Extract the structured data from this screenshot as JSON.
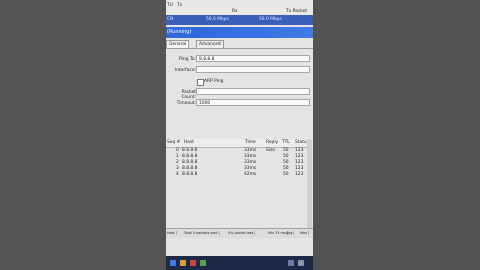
{
  "columns": {
    "col1": "TU",
    "col2": "Tx",
    "col3": "Rx",
    "col4": "Tx Packet",
    "col5": "R"
  },
  "interface_row": {
    "name": "CN",
    "tx_rate": "56.0 Mbps",
    "rx_rate": "56.0 Mbps"
  },
  "window": {
    "title": "(Running)"
  },
  "tabs": [
    "General",
    "Advanced"
  ],
  "form": {
    "ping_to_label": "Ping To:",
    "ping_to_value": "8.8.8.8",
    "interface_label": "Interface:",
    "interface_value": "",
    "arp_ping_label": "ARP Ping",
    "packet_count_label": "Packet Count:",
    "packet_count_value": "",
    "timeout_label": "Timeout:",
    "timeout_value": "1000"
  },
  "results": {
    "headers": [
      "Seq #",
      "Host",
      "Time",
      "Reply Size",
      "TTL",
      "Status"
    ],
    "rows": [
      {
        "seq": "0",
        "host": "8.8.8.8",
        "time": "33ms",
        "size": "50",
        "ttl": "123"
      },
      {
        "seq": "1",
        "host": "8.8.8.8",
        "time": "33ms",
        "size": "50",
        "ttl": "123"
      },
      {
        "seq": "2",
        "host": "8.8.8.8",
        "time": "33ms",
        "size": "50",
        "ttl": "123"
      },
      {
        "seq": "3",
        "host": "8.8.8.8",
        "time": "33ms",
        "size": "50",
        "ttl": "123"
      },
      {
        "seq": "4",
        "host": "8.8.8.8",
        "time": "42ms",
        "size": "50",
        "ttl": "123"
      }
    ]
  },
  "statusbar": {
    "items": [
      "Host",
      "Total 5 packets sent",
      "0% packet loss",
      "Min 33 ms",
      "Avg",
      "Max"
    ]
  },
  "colors": {
    "title_bar": "#2f66d8",
    "interface_row": "#3a5fb8",
    "taskbar": "#1e2a45"
  }
}
